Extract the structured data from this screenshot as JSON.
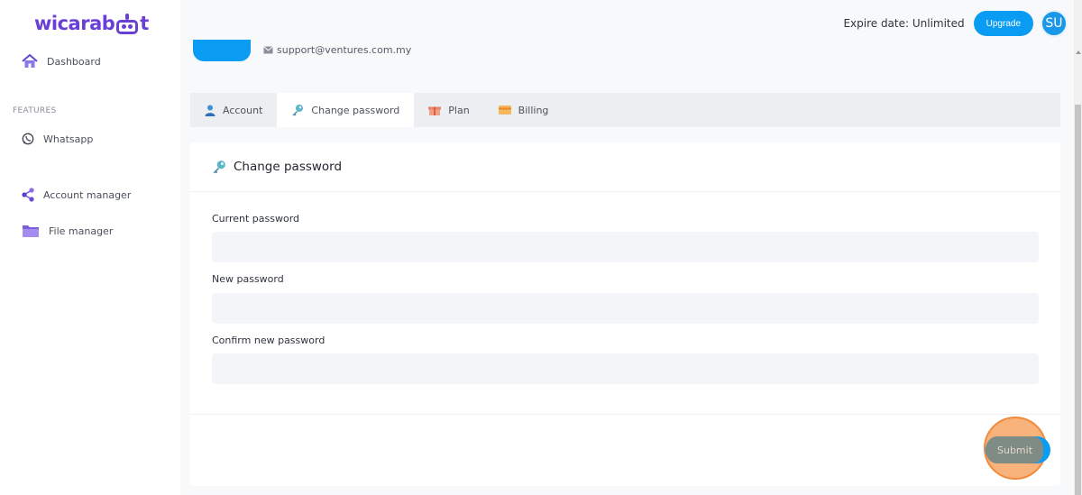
{
  "app": {
    "logo_text_left": "wicarab",
    "logo_text_right": "t"
  },
  "sidebar": {
    "dashboard_label": "Dashboard",
    "section_label": "FEATURES",
    "items": [
      {
        "label": "Whatsapp",
        "icon": "whatsapp-icon"
      },
      {
        "label": "Account manager",
        "icon": "share-nodes-icon"
      },
      {
        "label": "File manager",
        "icon": "folder-icon"
      }
    ]
  },
  "topbar": {
    "expire_text": "Expire date: Unlimited",
    "upgrade_label": "Upgrade",
    "avatar_initials": "SU"
  },
  "profile": {
    "email": "support@ventures.com.my"
  },
  "tabs": [
    {
      "label": "Account",
      "icon": "user-icon",
      "active": false
    },
    {
      "label": "Change password",
      "icon": "key-icon",
      "active": true
    },
    {
      "label": "Plan",
      "icon": "gift-icon",
      "active": false
    },
    {
      "label": "Billing",
      "icon": "credit-card-icon",
      "active": false
    }
  ],
  "form": {
    "title": "Change password",
    "fields": [
      {
        "label": "Current password",
        "value": ""
      },
      {
        "label": "New password",
        "value": ""
      },
      {
        "label": "Confirm new password",
        "value": ""
      }
    ],
    "submit_label": "Submit"
  },
  "colors": {
    "brand": "#6a3fd6",
    "accent": "#0a9cf2",
    "highlight": "#f7b37b"
  }
}
